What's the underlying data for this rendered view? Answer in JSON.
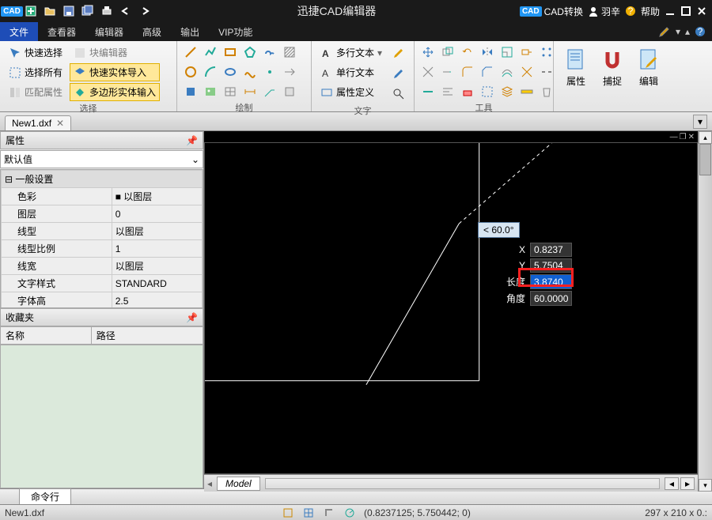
{
  "titlebar": {
    "title": "迅捷CAD编辑器",
    "right": {
      "convert": "CAD转换",
      "user": "羽辛",
      "help": "帮助"
    }
  },
  "menu": {
    "items": [
      "文件",
      "查看器",
      "编辑器",
      "高级",
      "输出",
      "VIP功能"
    ],
    "active_index": 0
  },
  "ribbon": {
    "select": {
      "quick_select": "快速选择",
      "select_all": "选择所有",
      "match_props": "匹配属性",
      "block_editor": "块编辑器",
      "quick_solid_import": "快速实体导入",
      "poly_solid_input": "多边形实体输入",
      "label": "选择"
    },
    "draw_label": "绘制",
    "text": {
      "mtext": "多行文本",
      "stext": "单行文本",
      "attr_def": "属性定义",
      "label": "文字"
    },
    "tools_label": "工具",
    "big": {
      "props": "属性",
      "snap": "捕捉",
      "edit": "编辑"
    }
  },
  "doc": {
    "name": "New1.dxf"
  },
  "props_panel": {
    "title": "属性",
    "default": "默认值",
    "section": "一般设置",
    "rows": [
      {
        "k": "色彩",
        "v": "■ 以图层"
      },
      {
        "k": "图层",
        "v": "0"
      },
      {
        "k": "线型",
        "v": "以图层"
      },
      {
        "k": "线型比例",
        "v": "1"
      },
      {
        "k": "线宽",
        "v": "以图层"
      },
      {
        "k": "文字样式",
        "v": "STANDARD"
      },
      {
        "k": "字体高",
        "v": "2.5"
      }
    ]
  },
  "fav_panel": {
    "title": "收藏夹",
    "col1": "名称",
    "col2": "路径"
  },
  "canvas": {
    "angle": "< 60.0°",
    "rows": [
      {
        "k": "X",
        "v": "0.8237"
      },
      {
        "k": "Y",
        "v": "5.7504"
      },
      {
        "k": "长度",
        "v": "3.8740",
        "hl": true
      },
      {
        "k": "角度",
        "v": "60.0000"
      }
    ],
    "model_tab": "Model"
  },
  "cmdline": {
    "tab": "命令行"
  },
  "status": {
    "file": "New1.dxf",
    "coords": "(0.8237125; 5.750442; 0)",
    "dims": "297 x 210 x 0.:"
  }
}
